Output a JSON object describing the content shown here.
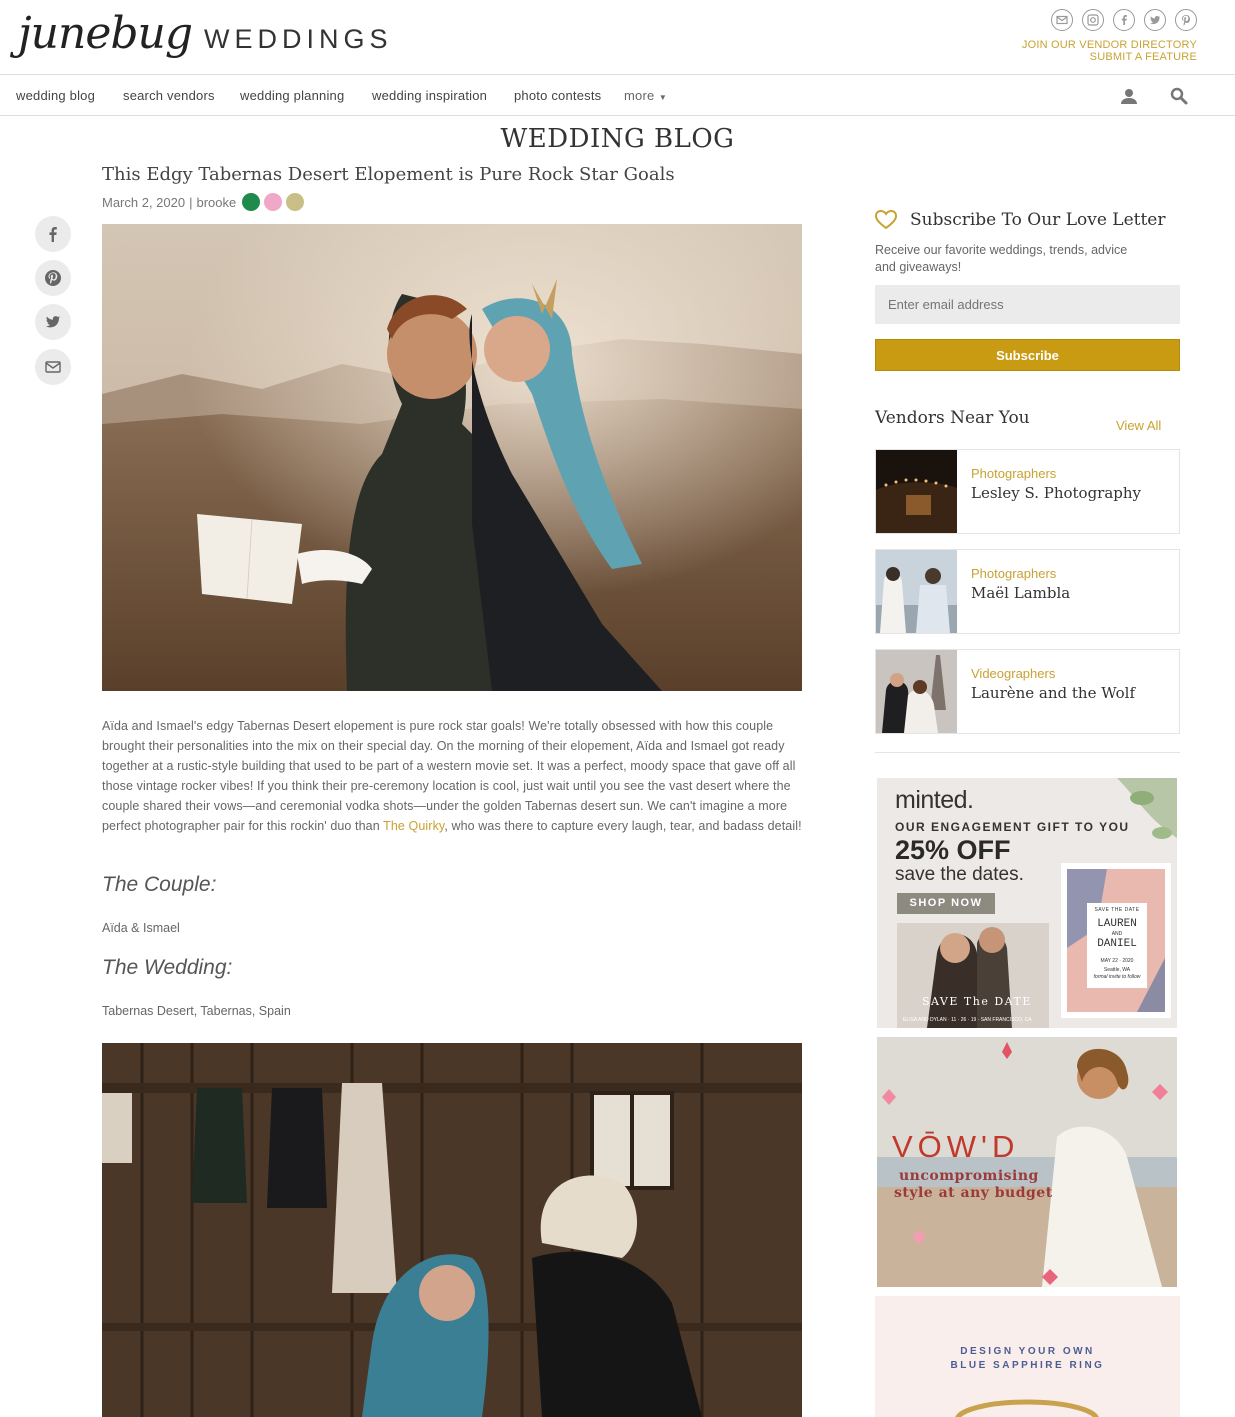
{
  "header": {
    "logo_script": "junebug",
    "logo_word": "WEDDINGS",
    "vendor_link_1": "JOIN OUR VENDOR DIRECTORY",
    "vendor_link_2": "SUBMIT A FEATURE",
    "social_icons": [
      "mail-icon",
      "instagram-icon",
      "facebook-icon",
      "twitter-icon",
      "pinterest-icon"
    ]
  },
  "nav": {
    "items": [
      "wedding blog",
      "search vendors",
      "wedding planning",
      "wedding inspiration",
      "photo contests",
      "more"
    ]
  },
  "page_title": "WEDDING BLOG",
  "post": {
    "title": "This Edgy Tabernas Desert Elopement is Pure Rock Star Goals",
    "date": "March 2, 2020",
    "separator": "|",
    "author": "brooke",
    "palette": [
      "#1f8a4c",
      "#f0a8c8",
      "#c9bf86"
    ],
    "body_1": "Aïda and Ismael's edgy Tabernas Desert elopement is pure rock star goals! We're totally obsessed with how this couple brought their personalities into the mix on their special day. On the morning of their elopement, Aïda and Ismael got ready together at a rustic-style building that used to be part of a western movie set. It was a perfect, moody space that gave off all those vintage rocker vibes! If you think their pre-ceremony location is cool, just wait until you see the vast desert where the couple shared their vows—and ceremonial vodka shots—under the golden Tabernas desert sun. We can't imagine a more perfect photographer pair for this rockin' duo than ",
    "body_link": "The Quirky",
    "body_2": ", who was there to capture every laugh, tear, and badass detail!",
    "couple_heading": "The Couple:",
    "couple_value": "Aïda & Ismael",
    "wedding_heading": "The Wedding:",
    "wedding_value": "Tabernas Desert, Tabernas, Spain"
  },
  "share_icons": [
    "facebook-icon",
    "pinterest-icon",
    "twitter-icon",
    "mail-icon"
  ],
  "sidebar": {
    "subscribe_title": "Subscribe To Our Love Letter",
    "subscribe_desc": "Receive our favorite weddings, trends, advice and giveaways!",
    "email_placeholder": "Enter email address",
    "subscribe_button": "Subscribe",
    "vendors_title": "Vendors Near You",
    "view_all": "View All",
    "vendors": [
      {
        "category": "Photographers",
        "name": "Lesley S. Photography"
      },
      {
        "category": "Photographers",
        "name": "Maël Lambla"
      },
      {
        "category": "Videographers",
        "name": "Laurène and the Wolf"
      }
    ]
  },
  "ads": {
    "minted": {
      "brand": "minted.",
      "tagline": "OUR ENGAGEMENT GIFT TO YOU",
      "offer": "25% OFF",
      "sub": "save the dates.",
      "cta": "SHOP NOW",
      "card_script": "SAVE The DATE",
      "card_line": "ELISA AND DYLAN · 11 · 26 · 19 · SAN FRANCISCO, CA",
      "card2_top": "SAVE THE DATE",
      "card2_name_1": "LAUREN",
      "card2_and": "AND",
      "card2_name_2": "DANIEL",
      "card2_date": "MAY 22 · 2020",
      "card2_city": "Seattle, WA",
      "card2_note": "formal invite to follow"
    },
    "vowd": {
      "brand": "VŌW'D",
      "line_1": "uncompromising",
      "line_2": "style at any budget"
    },
    "ring": {
      "line_1": "DESIGN YOUR OWN",
      "line_2": "BLUE SAPPHIRE RING"
    }
  }
}
